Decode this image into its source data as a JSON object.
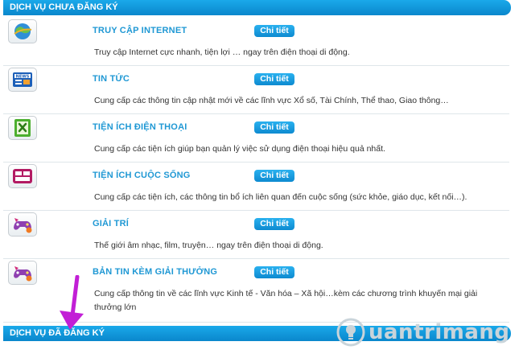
{
  "sections": {
    "unregistered_title": "DỊCH VỤ CHƯA ĐĂNG KÝ",
    "registered_title": "DỊCH VỤ ĐÃ ĐĂNG KÝ"
  },
  "detail_label": "Chi tiết",
  "services": [
    {
      "title": "TRUY CẬP INTERNET",
      "description": "Truy cập Internet cực nhanh, tiện lợi … ngay trên điện thoại di động.",
      "icon": "globe-icon"
    },
    {
      "title": "TIN TỨC",
      "description": "Cung cấp các thông tin cập nhật mới về các lĩnh vực Xổ số, Tài Chính, Thể thao, Giao thông…",
      "icon": "news-icon"
    },
    {
      "title": "TIỆN ÍCH ĐIỆN THOẠI",
      "description": "Cung cấp các tiện ích giúp bạn quản lý việc sử dụng điện thoại hiệu quả nhất.",
      "icon": "phone-tools-icon"
    },
    {
      "title": "TIỆN ÍCH CUỘC SỐNG",
      "description": "Cung cấp các tiện ích, các thông tin bổ ích liên quan đến cuộc sống (sức khỏe, giáo dục, kết nối…).",
      "icon": "life-utility-icon"
    },
    {
      "title": "GIẢI TRÍ",
      "description": "Thế giới âm nhạc, film, truyện… ngay trên điện thoại di động.",
      "icon": "entertainment-icon"
    },
    {
      "title": "BẢN TIN KÈM GIẢI THƯỞNG",
      "description": "Cung cấp thông tin về các lĩnh vực Kinh tế - Văn hóa – Xã hội…kèm các chương trình khuyến mại giải thưởng lớn",
      "icon": "prize-news-icon"
    }
  ],
  "watermark": {
    "text": "uantrimang"
  },
  "colors": {
    "accent": "#1aa9ea",
    "title": "#1f98d4",
    "arrow": "#c21fd6"
  }
}
